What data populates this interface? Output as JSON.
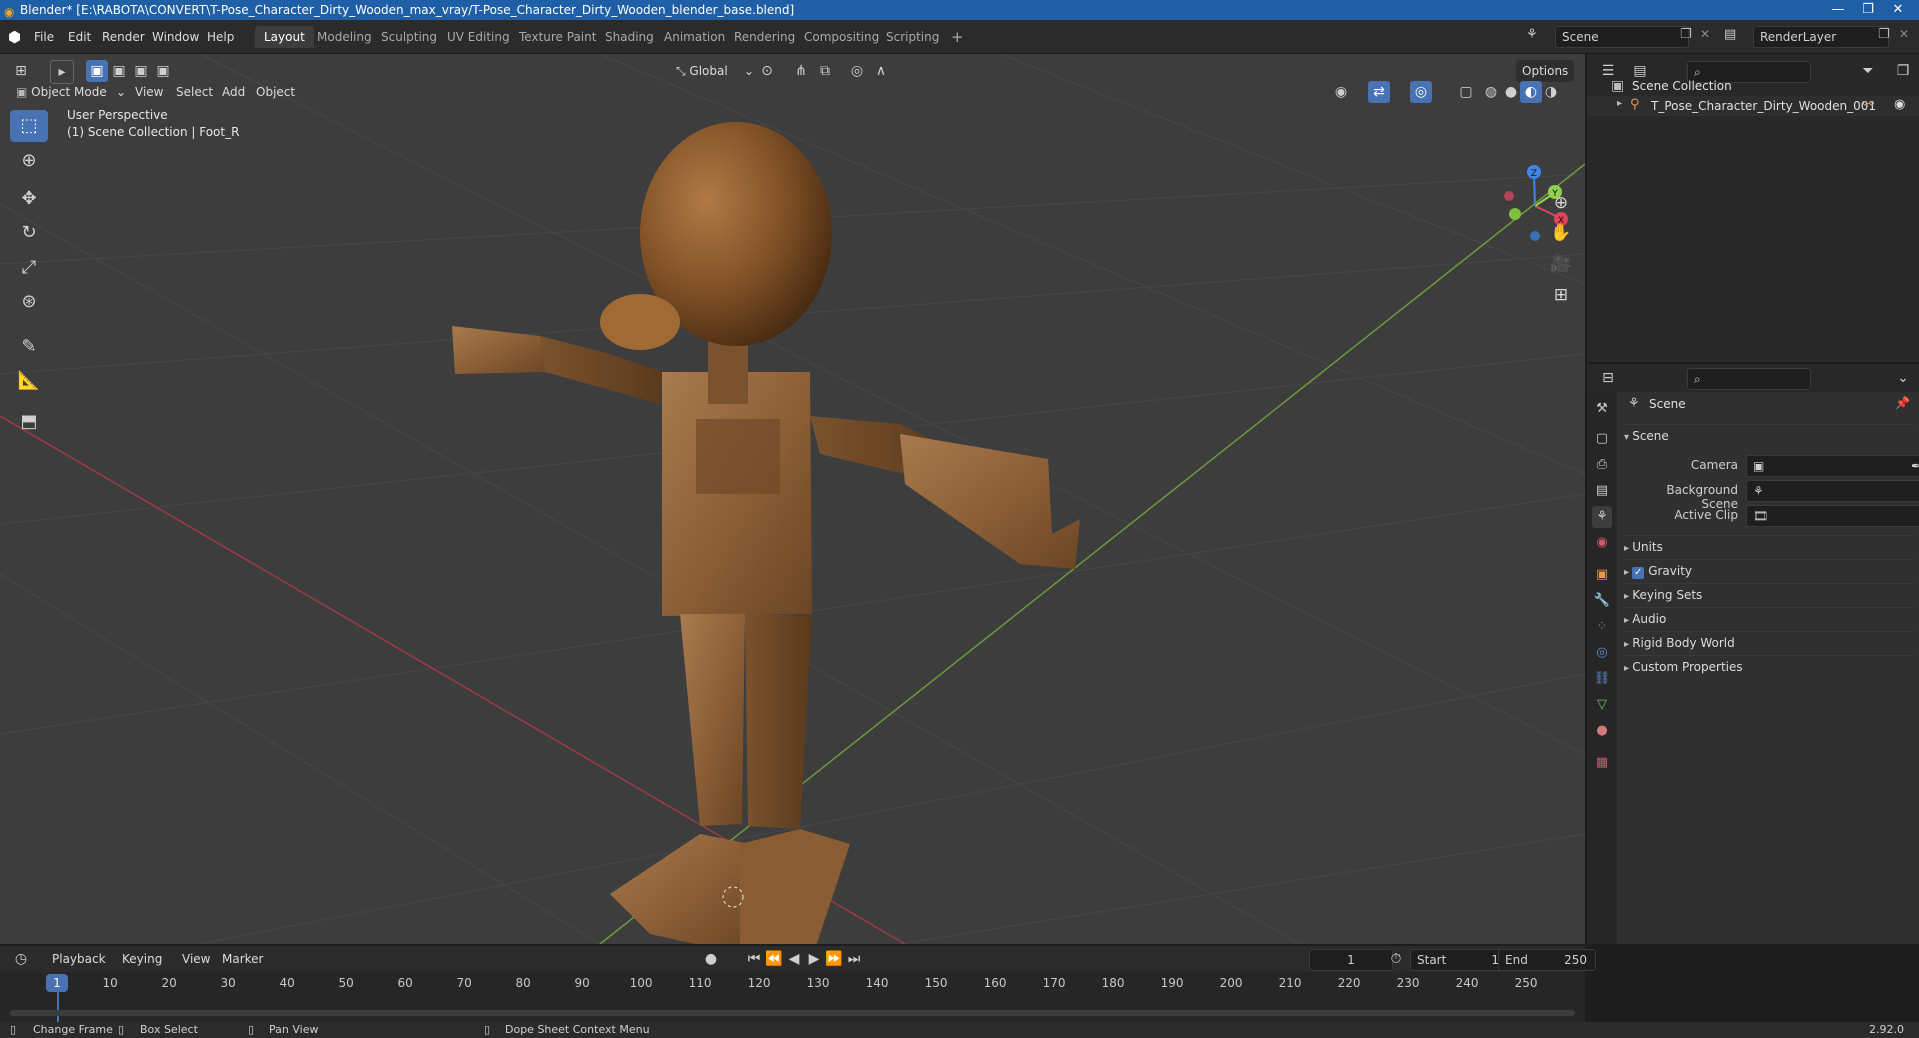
{
  "window": {
    "title": "Blender* [E:\\RABOTA\\CONVERT\\T-Pose_Character_Dirty_Wooden_max_vray/T-Pose_Character_Dirty_Wooden_blender_base.blend]",
    "minimize": "—",
    "restore": "❐",
    "close": "✕"
  },
  "menu": {
    "items": [
      "File",
      "Edit",
      "Render",
      "Window",
      "Help"
    ],
    "workspaces": [
      "Layout",
      "Modeling",
      "Sculpting",
      "UV Editing",
      "Texture Paint",
      "Shading",
      "Animation",
      "Rendering",
      "Compositing",
      "Scripting"
    ],
    "active_workspace": "Layout",
    "add_workspace": "+",
    "scene_name": "Scene",
    "view_layer": "RenderLayer"
  },
  "viewport_header": {
    "mode": "Object Mode",
    "menus": [
      "View",
      "Select",
      "Add",
      "Object"
    ],
    "transform_orientation": "Global",
    "options": "Options"
  },
  "viewport": {
    "perspective": "User Perspective",
    "collection_info": "(1) Scene Collection | Foot_R",
    "gizmo": {
      "x": "X",
      "y": "Y",
      "z": "Z"
    }
  },
  "outliner": {
    "root": "Scene Collection",
    "object": "T_Pose_Character_Dirty_Wooden_001"
  },
  "properties": {
    "context": "Scene",
    "panel_title": "Scene",
    "camera_label": "Camera",
    "background_scene_label": "Background Scene",
    "active_clip_label": "Active Clip",
    "subpanels": [
      "Units",
      "Gravity",
      "Keying Sets",
      "Audio",
      "Rigid Body World",
      "Custom Properties"
    ],
    "gravity_checked": true
  },
  "timeline": {
    "menus": [
      "Playback",
      "Keying",
      "View",
      "Marker"
    ],
    "current_frame": "1",
    "start_label": "Start",
    "start_value": "1",
    "end_label": "End",
    "end_value": "250",
    "playhead_label": "1",
    "ticks": [
      "10",
      "20",
      "30",
      "40",
      "50",
      "60",
      "70",
      "80",
      "90",
      "100",
      "110",
      "120",
      "130",
      "140",
      "150",
      "160",
      "170",
      "180",
      "190",
      "200",
      "210",
      "220",
      "230",
      "240",
      "250"
    ]
  },
  "statusbar": {
    "change_frame": "Change Frame",
    "box_select": "Box Select",
    "pan_view": "Pan View",
    "context_menu": "Dope Sheet Context Menu",
    "version": "2.92.0"
  },
  "colors": {
    "accent": "#4772b3",
    "titlebar": "#1f5fa6",
    "axis_x": "#e0425b",
    "axis_y": "#8fd14f",
    "axis_z": "#3f87e6"
  }
}
